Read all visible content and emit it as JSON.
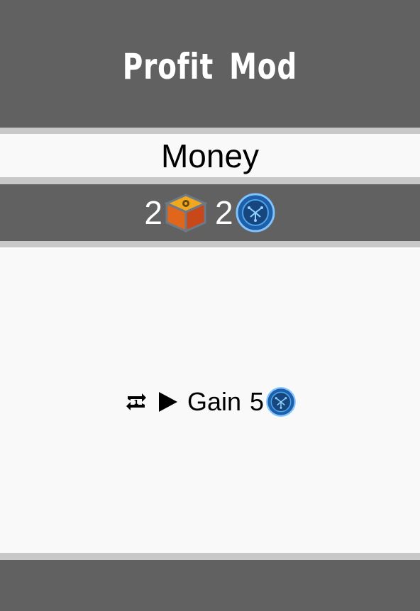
{
  "card": {
    "title": "Profit Mod",
    "type": "Money",
    "cost": [
      {
        "amount": "2",
        "icon": "crate-icon"
      },
      {
        "amount": "2",
        "icon": "credit-coin-icon"
      }
    ],
    "effect": {
      "trigger_icon": "repeat-once-icon",
      "arrow_icon": "play-arrow-icon",
      "text": "Gain",
      "amount": "5",
      "resource_icon": "credit-coin-icon"
    }
  },
  "colors": {
    "dark_band": "#616161",
    "light_panel": "#f9f9f9",
    "separator": "#c8c8c8"
  }
}
